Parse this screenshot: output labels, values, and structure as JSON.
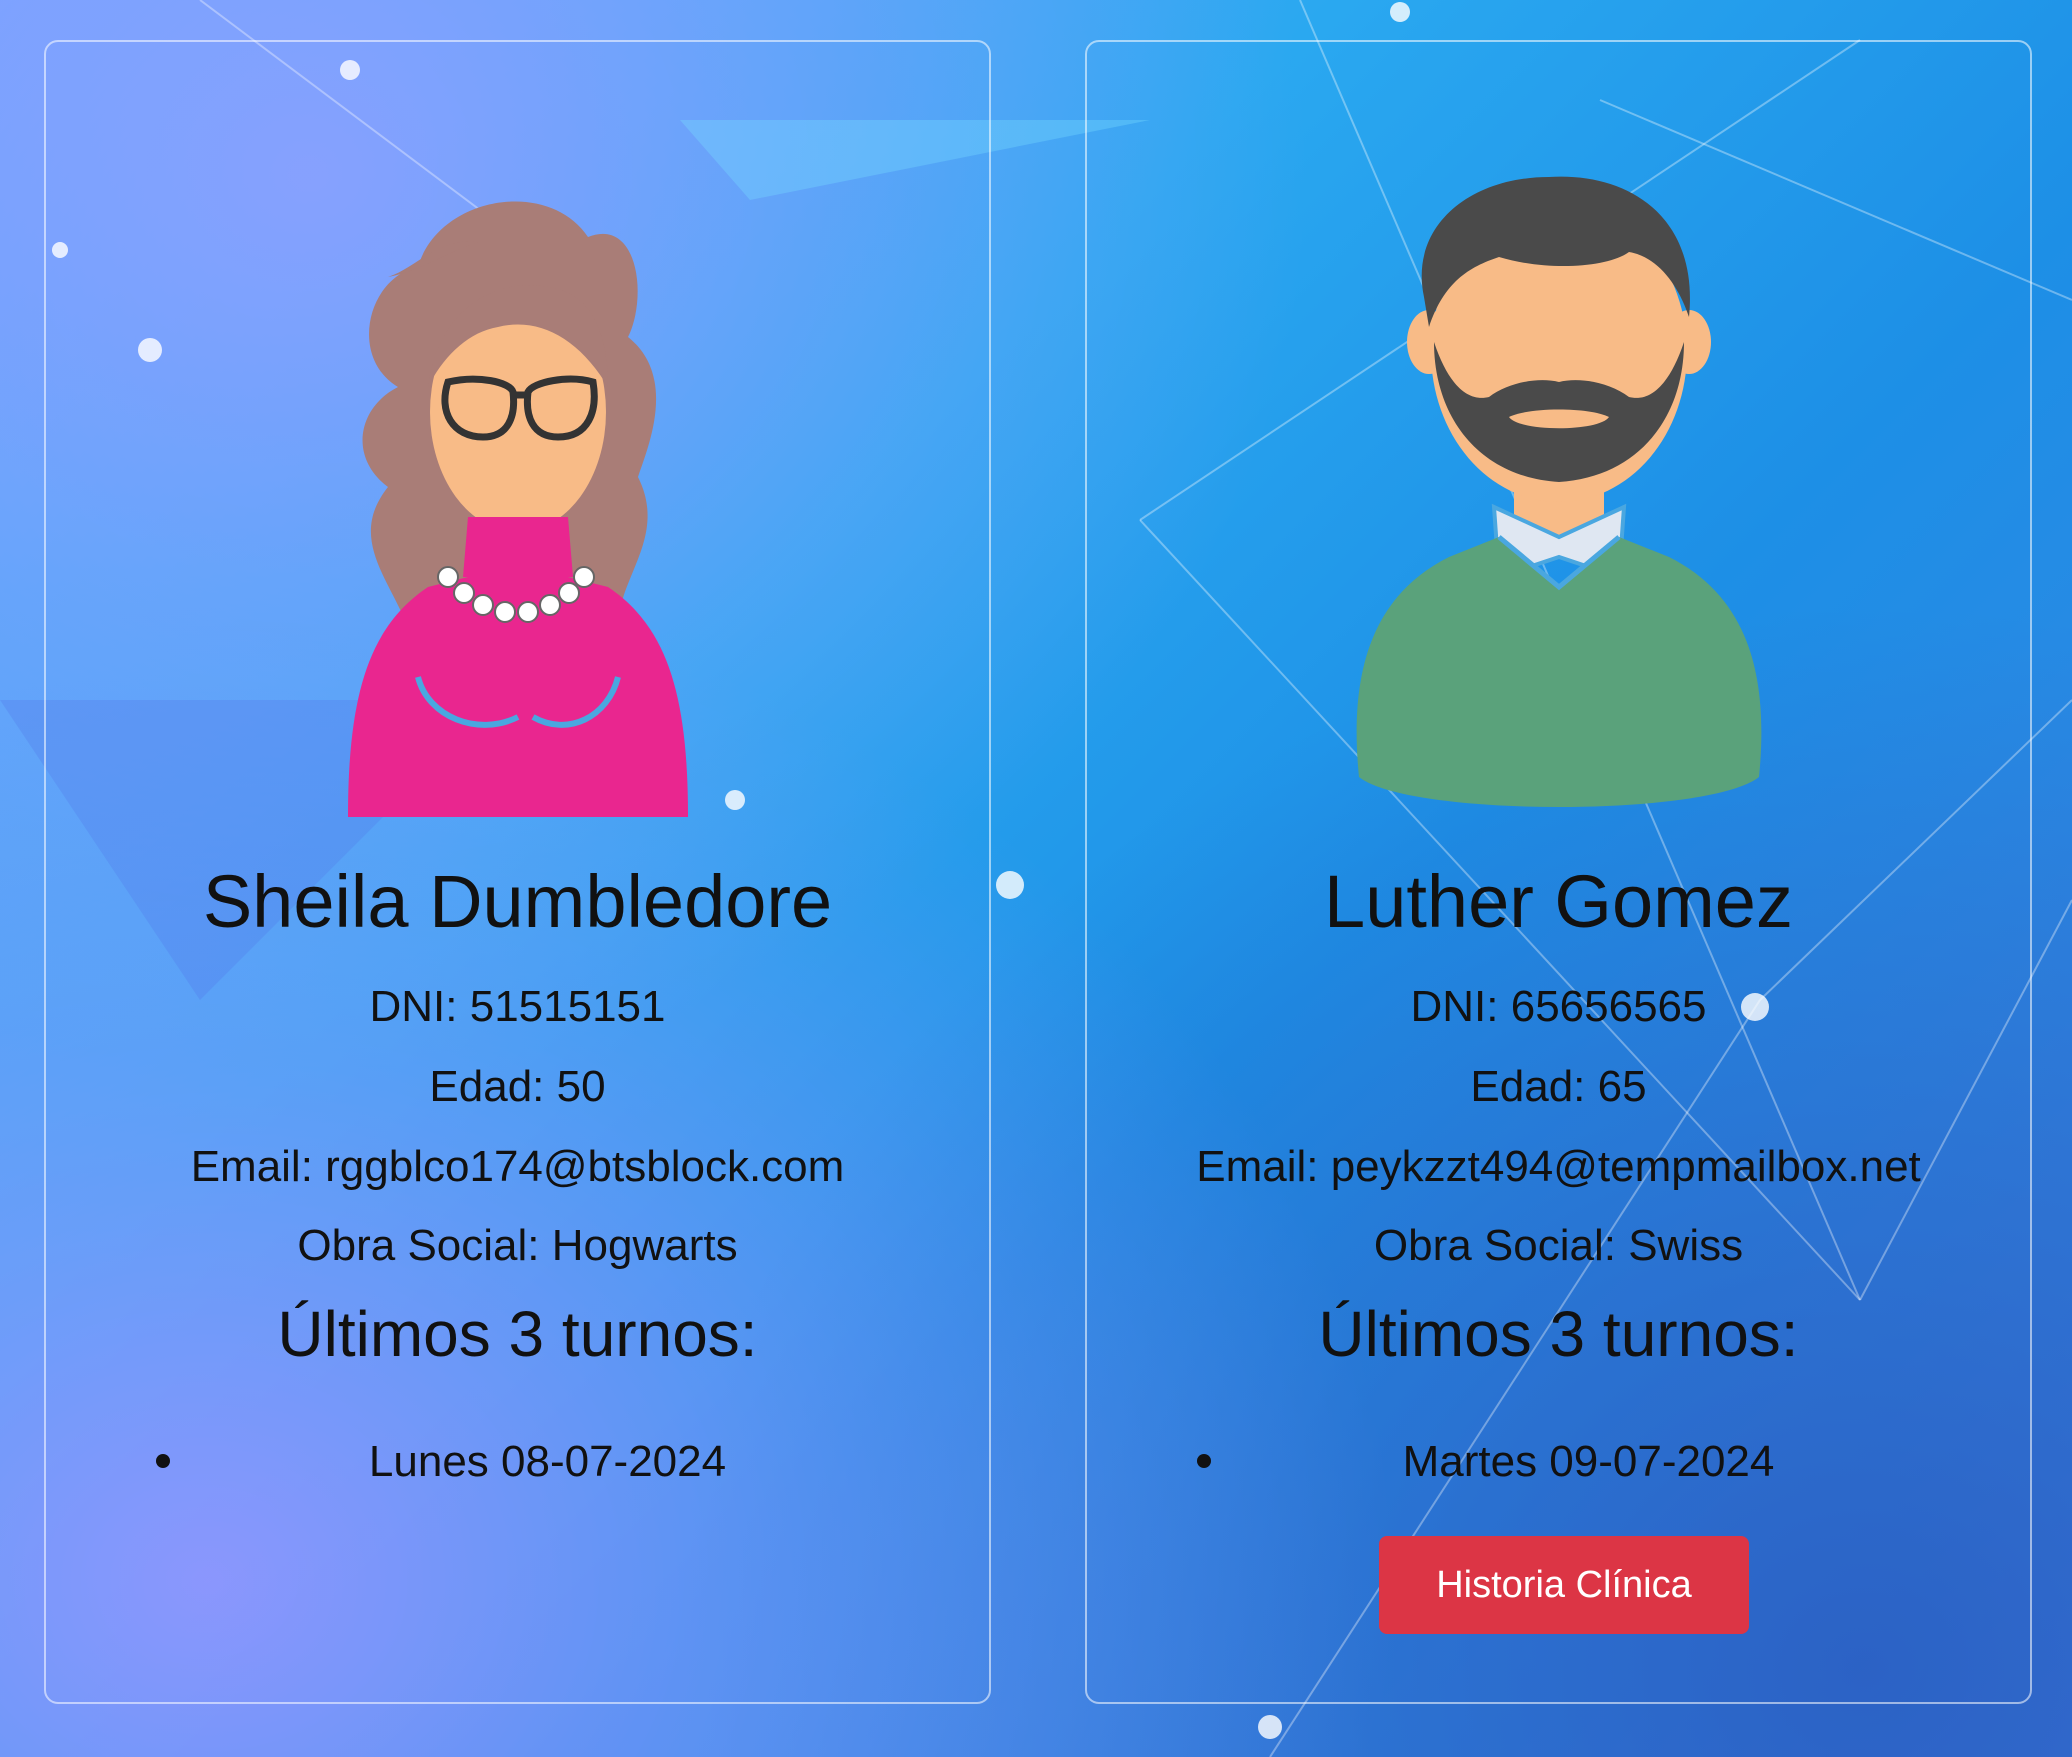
{
  "patients": [
    {
      "name": "Sheila Dumbledore",
      "dni": "DNI: 51515151",
      "edad": "Edad: 50",
      "email": "Email: rggblco174@btsblock.com",
      "obra_social": "Obra Social: Hogwarts",
      "turnos_title": "Últimos 3 turnos:",
      "turnos": [
        "Lunes 08-07-2024"
      ],
      "avatar_icon": "woman-avatar-icon"
    },
    {
      "name": "Luther Gomez",
      "dni": "DNI: 65656565",
      "edad": "Edad: 65",
      "email": "Email: peykzzt494@tempmailbox.net",
      "obra_social": "Obra Social: Swiss",
      "turnos_title": "Últimos 3 turnos:",
      "turnos": [
        "Martes 09-07-2024"
      ],
      "avatar_icon": "man-avatar-icon",
      "button_label": "Historia Clínica"
    }
  ],
  "colors": {
    "button": "#dc3545",
    "card_border": "rgba(255,255,255,0.55)"
  }
}
